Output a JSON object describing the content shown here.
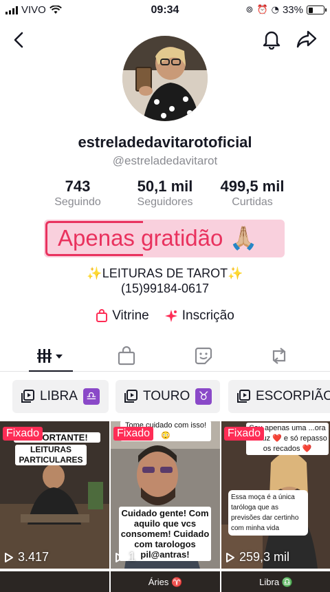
{
  "status_bar": {
    "carrier": "VIVO",
    "time": "09:34",
    "battery": "33%",
    "battery_level": 0.33
  },
  "profile": {
    "username": "estreladedavitarotoficial",
    "handle": "@estreladedavitarot",
    "stats": [
      {
        "value": "743",
        "label": "Seguindo"
      },
      {
        "value": "50,1 mil",
        "label": "Seguidores"
      },
      {
        "value": "499,5 mil",
        "label": "Curtidas"
      }
    ],
    "highlight_text": "Apenas gratidão 🙏🏼",
    "bio_line1": "✨LEITURAS DE TAROT✨",
    "bio_line2": "(15)99184-0617",
    "links": [
      {
        "label": "Vitrine",
        "icon": "shopping-bag-icon"
      },
      {
        "label": "Inscrição",
        "icon": "sparkle-icon"
      }
    ]
  },
  "tabs": [
    "videos-grid-icon",
    "shop-icon",
    "favorites-icon",
    "repost-icon"
  ],
  "playlists": [
    {
      "label": "LIBRA",
      "zodiac": "♎"
    },
    {
      "label": "TOURO",
      "zodiac": "♉"
    },
    {
      "label": "ESCORPIÃO",
      "zodiac": "♏"
    }
  ],
  "videos": [
    {
      "pinned": "Fixado",
      "views": "3.417",
      "caption_top": "IMPORTANTE!",
      "caption_sub": "LEITURAS PARTICULARES"
    },
    {
      "pinned": "Fixado",
      "views": "1",
      "caption_top": "Tome cuidado com isso! 😳",
      "caption_main": "Cuidado gente! Com aquilo que vcs consomem! Cuidado com tarologos pil@antras!"
    },
    {
      "pinned": "Fixado",
      "views": "259,3 mil",
      "caption_top": "Sou apenas uma ...ora da Luz ❤️ e só repasso os recados ❤️",
      "caption_comment": "Essa moça é a única taróloga que as previsões dar certinho com minha vida"
    }
  ],
  "row2_labels": [
    "",
    "Áries ♈",
    "Libra ♎"
  ],
  "colors": {
    "accent": "#fe2c55",
    "highlight_bg": "#f9d0dd",
    "highlight_text": "#e9325e",
    "zodiac": "#8a49c8"
  }
}
